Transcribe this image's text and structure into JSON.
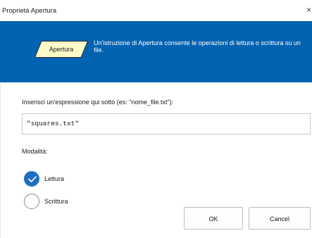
{
  "window": {
    "title": "Proprietà Apertura",
    "close_glyph": "×"
  },
  "banner": {
    "shape_label": "Apertura",
    "description": "Un'istruzione di Apertura consente le operazioni di lettura o scrittura su un file.",
    "colors": {
      "background": "#0062b0",
      "shape_fill": "#fffbc8"
    }
  },
  "expression": {
    "label": "Inserisci un'espressione qui sotto (es: \"nome_file.txt\"):",
    "value": "\"squares.txt\""
  },
  "mode": {
    "label": "Modalità:",
    "options": [
      {
        "label": "Lettura",
        "selected": true
      },
      {
        "label": "Scrittura",
        "selected": false
      }
    ]
  },
  "buttons": {
    "ok": "OK",
    "cancel": "Cancel"
  },
  "accent_color": "#1f6fc0"
}
